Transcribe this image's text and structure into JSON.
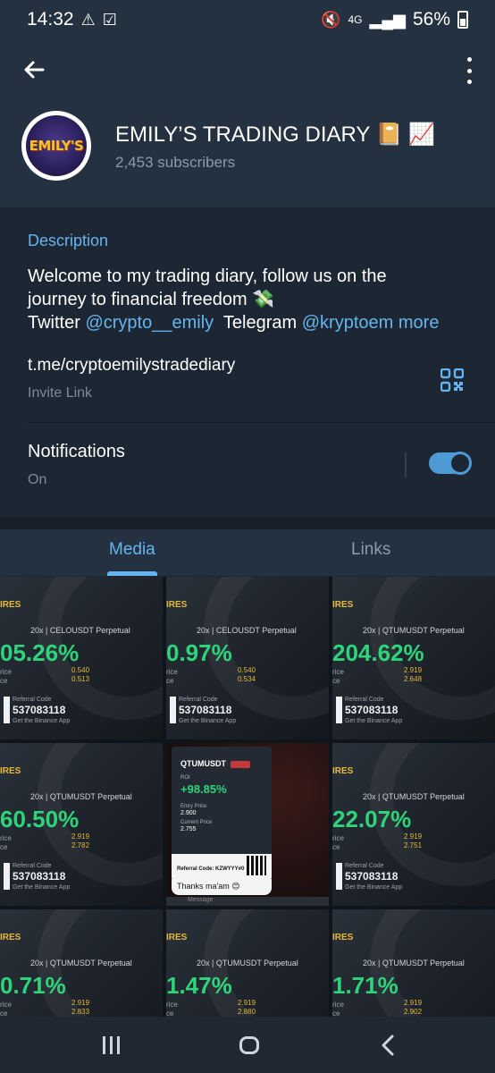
{
  "status_bar": {
    "time": "14:32",
    "network": "4G",
    "battery": "56%",
    "icons": [
      "warning-icon",
      "checkbox-icon",
      "mute-icon",
      "signal-icon",
      "battery-icon"
    ]
  },
  "header": {
    "title": "EMILY’S TRADING DIARY 📔 📈",
    "subscribers": "2,453 subscribers",
    "avatar_text": "EMILY'S"
  },
  "info": {
    "description_label": "Description",
    "description_line1": "Welcome to my trading diary, follow us on the",
    "description_line2": "journey to financial freedom 💸",
    "twitter_label": "Twitter",
    "twitter_handle": "@crypto__emily",
    "telegram_label": "Telegram",
    "telegram_handle": "@kryptoem",
    "more": "more",
    "invite_link": "t.me/cryptoemilystradediary",
    "invite_label": "Invite Link",
    "notifications_label": "Notifications",
    "notifications_status": "On",
    "notifications_on": true
  },
  "tabs": {
    "media": "Media",
    "links": "Links",
    "active": "media"
  },
  "media_tiles": [
    {
      "top": "IRES",
      "pair": "20x | CELOUSDT Perpetual",
      "pct": "05.26%",
      "lbl": "rice\nce",
      "price": "0.540\n0.513",
      "code_label": "Referral Code",
      "code": "537083118",
      "sub": "Get the Binance App"
    },
    {
      "top": "IRES",
      "pair": "20x | CELOUSDT Perpetual",
      "pct": "0.97%",
      "lbl": "rice\nce",
      "price": "0.540\n0.534",
      "code_label": "Referral Code",
      "code": "537083118",
      "sub": "Get the Binance App"
    },
    {
      "top": "IRES",
      "pair": "20x | QTUMUSDT Perpetual",
      "pct": "204.62%",
      "lbl": "rice\nce",
      "price": "2.919\n2.648",
      "code_label": "Referral Code",
      "code": "537083118",
      "sub": "Get the Binance App"
    },
    {
      "top": "IRES",
      "pair": "20x | QTUMUSDT Perpetual",
      "pct": "60.50%",
      "lbl": "rice\nce",
      "price": "2.919\n2.782",
      "code_label": "Referral Code",
      "code": "537083118",
      "sub": "Get the Binance App"
    },
    {
      "top": "IRES",
      "pair": "20x | QTUMUSDT Perpetual",
      "pct": "22.07%",
      "lbl": "rice\nce",
      "price": "2.919\n2.751",
      "code_label": "Referral Code",
      "code": "537083118",
      "sub": "Get the Binance App"
    },
    {
      "top": "IRES",
      "pair": "20x | QTUMUSDT Perpetual",
      "pct": "0.71%",
      "lbl": "rice\nce",
      "price": "2.919\n2.833",
      "code_label": "",
      "code": "",
      "sub": ""
    },
    {
      "top": "IRES",
      "pair": "20x | QTUMUSDT Perpetual",
      "pct": "1.47%",
      "lbl": "rice\nce",
      "price": "2.919\n2.880",
      "code_label": "",
      "code": "",
      "sub": ""
    },
    {
      "top": "IRES",
      "pair": "20x | QTUMUSDT Perpetual",
      "pct": "1.71%",
      "lbl": "rice\nce",
      "price": "2.919\n2.902",
      "code_label": "",
      "code": "",
      "sub": ""
    }
  ],
  "chat_tile": {
    "pair": "QTUMUSDT",
    "roi_label": "ROI",
    "pct": "+98.85%",
    "entry_label": "Entry Price",
    "entry": "2.900",
    "current_label": "Current Price",
    "current": "2.755",
    "referral": "Referral Code: KZWYYY#0",
    "thanks": "Thanks ma'am 😊",
    "message_placeholder": "Message"
  },
  "colors": {
    "accent": "#64b5ef",
    "header_bg": "#243140",
    "body_bg": "#1d2733",
    "profit_green": "#2ed47a"
  }
}
